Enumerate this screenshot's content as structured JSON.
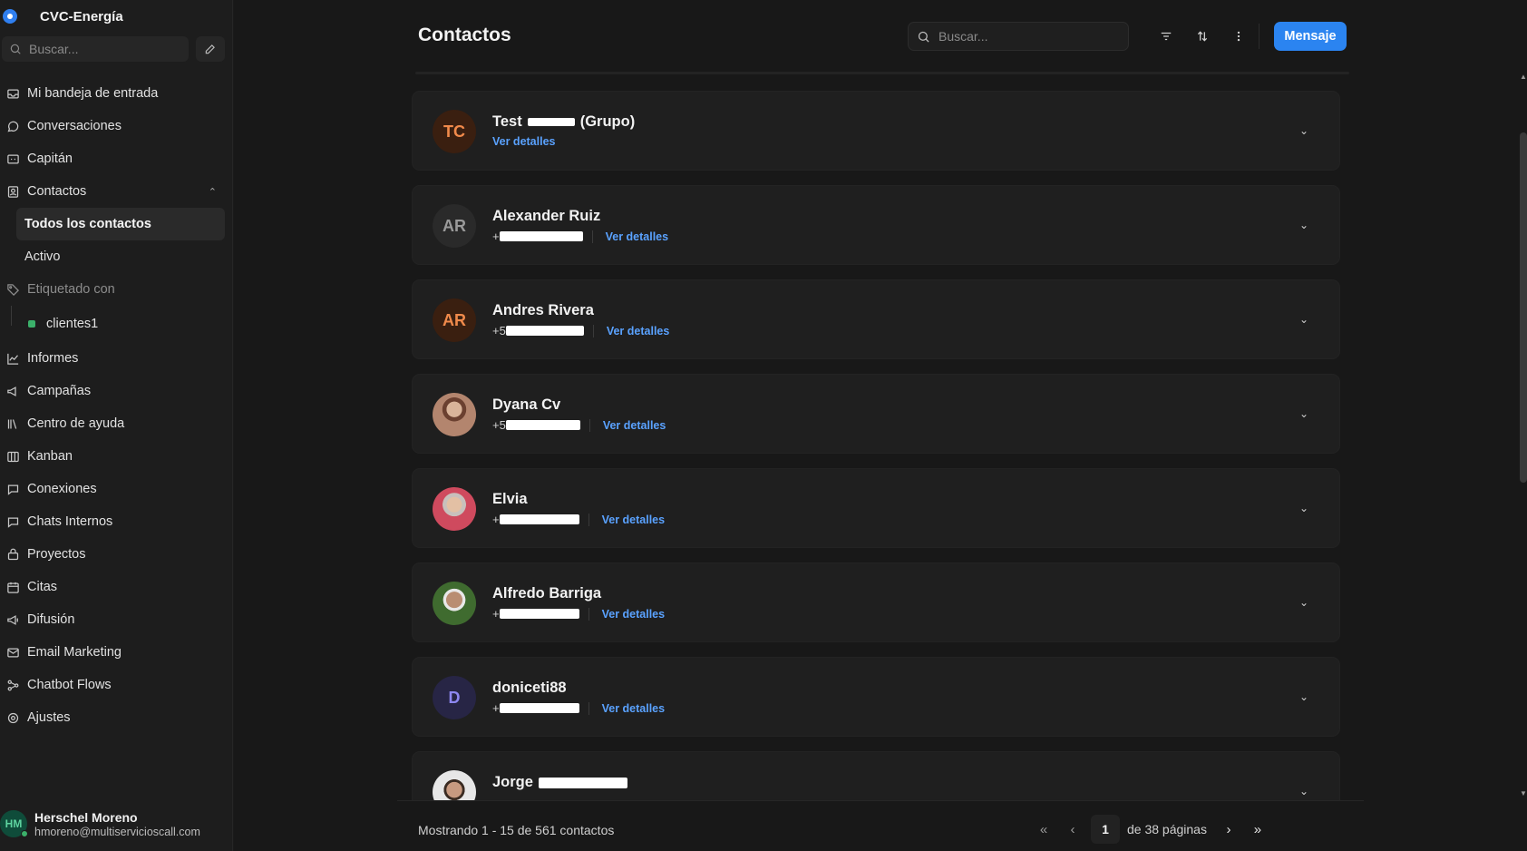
{
  "sidebar": {
    "brand": "CVC-Energía",
    "search_placeholder": "Buscar...",
    "items": [
      {
        "label": "Mi bandeja de entrada",
        "icon": "inbox-icon"
      },
      {
        "label": "Conversaciones",
        "icon": "chat-bubble-icon"
      },
      {
        "label": "Capitán",
        "icon": "bot-icon"
      },
      {
        "label": "Contactos",
        "icon": "contacts-icon"
      }
    ],
    "contacts_sub": [
      "Todos los contactos",
      "Activo"
    ],
    "tagged_label": "Etiquetado con",
    "tag": "clientes1",
    "items2": [
      {
        "label": "Informes",
        "icon": "chart-icon"
      },
      {
        "label": "Campañas",
        "icon": "megaphone-icon"
      },
      {
        "label": "Centro de ayuda",
        "icon": "library-icon"
      },
      {
        "label": "Kanban",
        "icon": "kanban-icon"
      },
      {
        "label": "Conexiones",
        "icon": "connections-icon"
      },
      {
        "label": "Chats Internos",
        "icon": "chat-icon"
      },
      {
        "label": "Proyectos",
        "icon": "folder-icon"
      },
      {
        "label": "Citas",
        "icon": "calendar-icon"
      },
      {
        "label": "Difusión",
        "icon": "broadcast-icon"
      },
      {
        "label": "Email Marketing",
        "icon": "mail-icon"
      },
      {
        "label": "Chatbot Flows",
        "icon": "flow-icon"
      },
      {
        "label": "Ajustes",
        "icon": "settings-icon"
      }
    ],
    "user": {
      "initials": "HM",
      "name": "Herschel Moreno",
      "email": "hmoreno@multiservicioscall.com"
    }
  },
  "header": {
    "title": "Contactos",
    "search_placeholder": "Buscar...",
    "message_button": "Mensaje"
  },
  "contacts": [
    {
      "initials": "TC",
      "name_pre": "Test",
      "name_post": "(Grupo)",
      "phone_prefix": "",
      "link": "Ver detalles"
    },
    {
      "initials": "AR",
      "name": "Alexander Ruiz",
      "phone_prefix": "+",
      "link": "Ver detalles"
    },
    {
      "initials": "AR",
      "name": "Andres Rivera",
      "phone_prefix": "+5",
      "link": "Ver detalles"
    },
    {
      "initials": "",
      "name": "Dyana Cv",
      "phone_prefix": "+5",
      "link": "Ver detalles"
    },
    {
      "initials": "",
      "name": "Elvia",
      "phone_prefix": "+",
      "link": "Ver detalles"
    },
    {
      "initials": "",
      "name": "Alfredo Barriga",
      "phone_prefix": "+",
      "link": "Ver detalles"
    },
    {
      "initials": "D",
      "name": "doniceti88",
      "phone_prefix": "+",
      "link": "Ver detalles"
    },
    {
      "initials": "",
      "name_pre": "Jorge",
      "phone_prefix": "",
      "link": ""
    }
  ],
  "footer": {
    "showing": "Mostrando 1 - 15 de 561 contactos",
    "page": "1",
    "of_pages": "de 38 páginas"
  },
  "colors": {
    "accent": "#2b84f0",
    "link": "#5aa2ff",
    "background": "#181818"
  }
}
